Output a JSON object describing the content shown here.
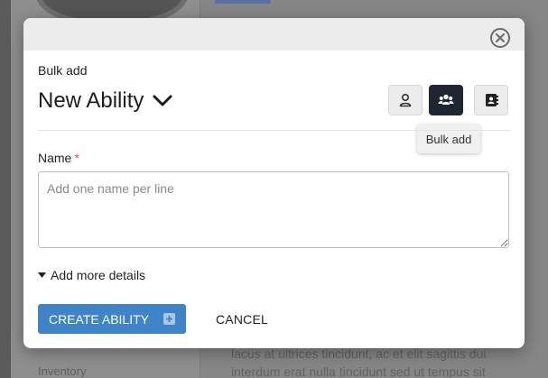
{
  "background": {
    "sidebar_item": "Inventory",
    "text_line1": "lacus at ultrices tincidunt, ac et elit sagittis dui",
    "text_line2": "interdum erat nulla tincidunt sed ut tempus sit"
  },
  "modal": {
    "subtitle": "Bulk add",
    "title": "New Ability",
    "modes": [
      {
        "icon": "user-icon",
        "label": "Single"
      },
      {
        "icon": "users-icon",
        "label": "Bulk add",
        "active": true
      },
      {
        "icon": "address-book-icon",
        "label": "Template"
      }
    ],
    "tooltip": "Bulk add",
    "name_field": {
      "label": "Name",
      "required_marker": "*",
      "placeholder": "Add one name per line",
      "value": ""
    },
    "more_details_label": "Add more details",
    "create_label": "CREATE ABILITY",
    "cancel_label": "CANCEL"
  },
  "colors": {
    "primary": "#3f84c8",
    "active_mode": "#1f2633",
    "required": "#d9534f"
  }
}
